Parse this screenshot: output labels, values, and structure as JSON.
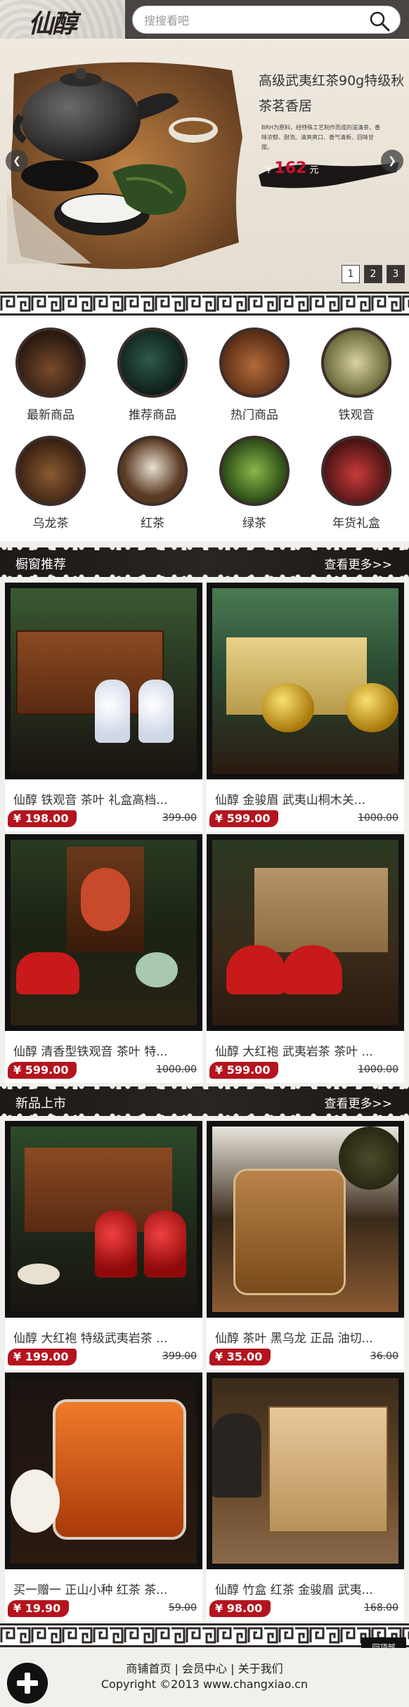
{
  "header": {
    "logo": "仙醇",
    "search_placeholder": "搜搜看吧"
  },
  "banner": {
    "title": "高级武夷红茶90g特级秋茶茗香居",
    "desc": "BRH为原料，经特殊工艺制作而成的滋清茶，香味浓郁、耐泡、清爽爽口、香气清新、回味甘甜。",
    "price_currency": "¥",
    "price": "162",
    "price_suffix": "元",
    "pages": [
      "1",
      "2",
      "3"
    ],
    "active_page": "1"
  },
  "categories": [
    {
      "label": "最新商品"
    },
    {
      "label": "推荐商品"
    },
    {
      "label": "热门商品"
    },
    {
      "label": "铁观音"
    },
    {
      "label": "乌龙茶"
    },
    {
      "label": "红茶"
    },
    {
      "label": "绿茶"
    },
    {
      "label": "年货礼盒"
    }
  ],
  "sections": [
    {
      "title": "橱窗推荐",
      "more": "查看更多>>",
      "products": [
        {
          "name": "仙醇 铁观音 茶叶 礼盒高档...",
          "price": "¥ 198.00",
          "old": "399.00"
        },
        {
          "name": "仙醇 金骏眉 武夷山桐木关...",
          "price": "¥ 599.00",
          "old": "1000.00"
        },
        {
          "name": "仙醇 清香型铁观音 茶叶 特...",
          "price": "¥ 599.00",
          "old": "1000.00"
        },
        {
          "name": "仙醇 大红袍 武夷岩茶 茶叶 ...",
          "price": "¥ 599.00",
          "old": "1000.00"
        }
      ]
    },
    {
      "title": "新品上市",
      "more": "查看更多>>",
      "products": [
        {
          "name": "仙醇 大红袍 特级武夷岩茶 ...",
          "price": "¥ 199.00",
          "old": "399.00"
        },
        {
          "name": "仙醇 茶叶 黑乌龙 正品 油切...",
          "price": "¥ 35.00",
          "old": "36.00"
        },
        {
          "name": "买一赠一 正山小种 红茶 茶...",
          "price": "¥ 19.90",
          "old": "59.00"
        },
        {
          "name": "仙醇 竹盒 红茶 金骏眉 武夷...",
          "price": "¥ 98.00",
          "old": "168.00"
        }
      ]
    }
  ],
  "footer": {
    "link_home": "商铺首页",
    "link_member": "会员中心",
    "link_about": "关于我们",
    "sep": "|",
    "copyright": "Copyright ©2013 www.changxiao.cn",
    "back_top": "回顶部"
  },
  "colors": {
    "header_bg": "#4a4442",
    "price_red": "#b4141e",
    "dark": "#2a2422"
  }
}
